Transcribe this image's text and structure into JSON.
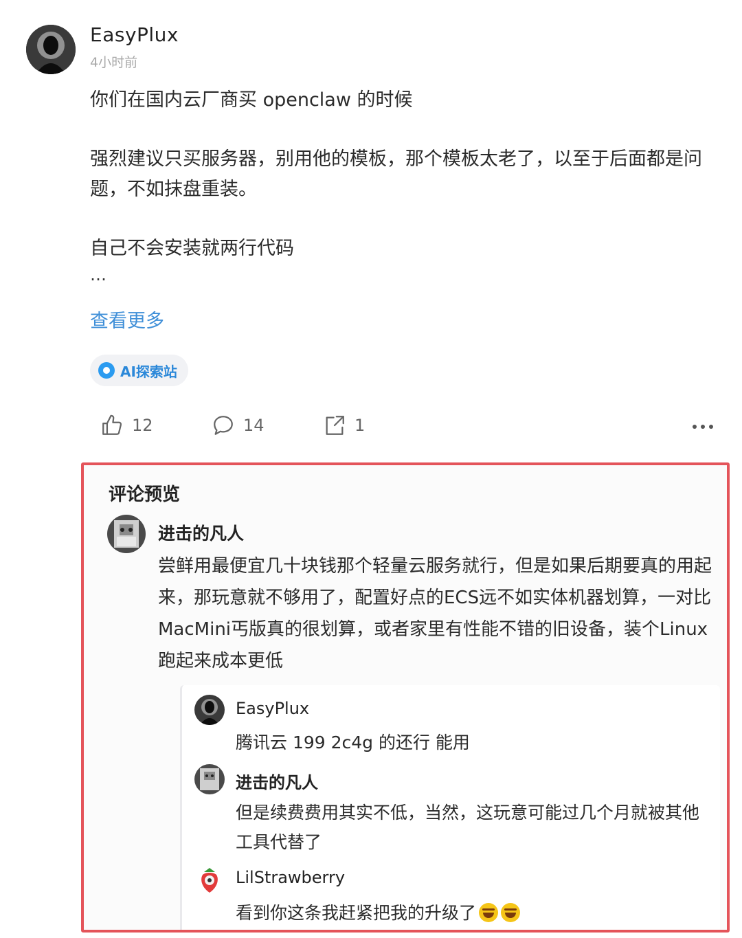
{
  "post": {
    "author": "EasyPlux",
    "time": "4小时前",
    "line1": "你们在国内云厂商买 openclaw 的时候",
    "line2": "强烈建议只买服务器，别用他的模板，那个模板太老了，以至于后面都是问题，不如抹盘重装。",
    "line3": "自己不会安装就两行代码",
    "ellipsis": "…",
    "see_more": "查看更多",
    "topic": "AI探索站",
    "topic_icon": "circle-icon"
  },
  "actions": {
    "like_count": "12",
    "comment_count": "14",
    "share_count": "1",
    "like_icon": "thumbs-up-icon",
    "comment_icon": "comment-bubble-icon",
    "share_icon": "share-icon",
    "more_icon": "more-dots-icon"
  },
  "comments_preview": {
    "title": "评论预览",
    "highlight_color": "#e4545a",
    "top_comment": {
      "author": "进击的凡人",
      "text": "尝鲜用最便宜几十块钱那个轻量云服务就行，但是如果后期要真的用起来，那玩意就不够用了，配置好点的ECS远不如实体机器划算，一对比MacMini丐版真的很划算，或者家里有性能不错的旧设备，装个Linux跑起来成本更低"
    },
    "replies": [
      {
        "author": "EasyPlux",
        "text": "腾讯云 199 2c4g 的还行 能用"
      },
      {
        "author": "进击的凡人",
        "text": "但是续费费用其实不低，当然，这玩意可能过几个月就被其他工具代替了"
      },
      {
        "author": "LilStrawberry",
        "text": "看到你这条我赶紧把我的升级了",
        "emoji": "rolling-laughing-emoji"
      }
    ]
  },
  "colors": {
    "link": "#3f8fd8",
    "topic_chip_bg": "#f1f2f5",
    "topic_text": "#2b88d9"
  }
}
